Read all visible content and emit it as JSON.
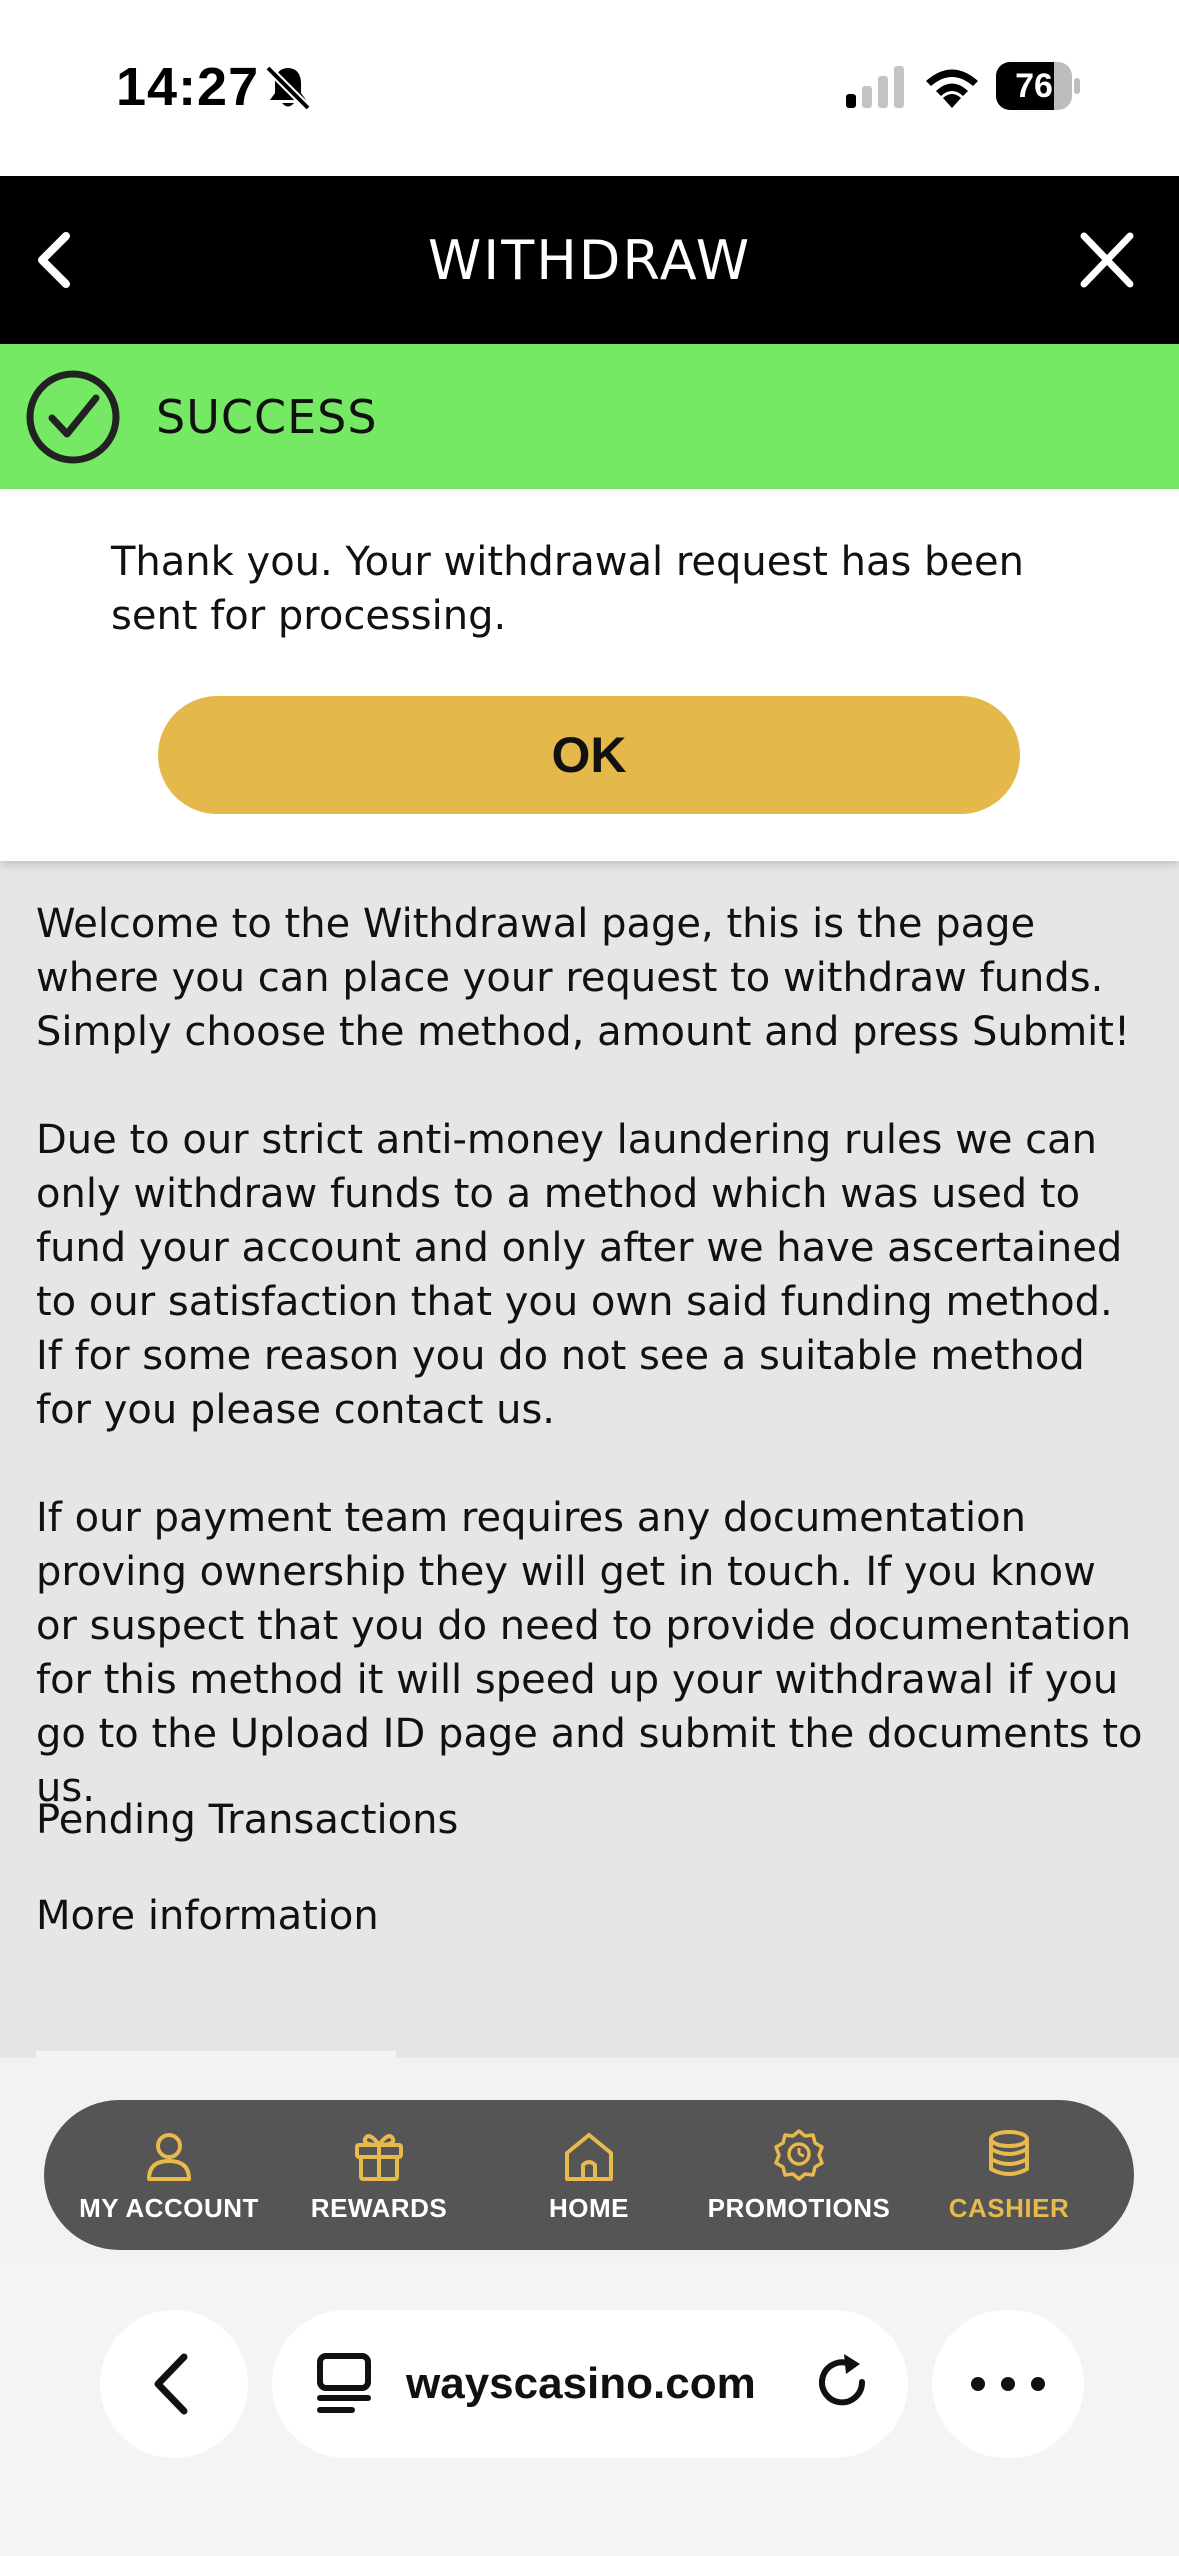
{
  "status_bar": {
    "time": "14:27",
    "battery": "76",
    "battery_level": 0.76
  },
  "header": {
    "title": "WITHDRAW"
  },
  "success": {
    "label": "SUCCESS",
    "color": "#76e964"
  },
  "message": {
    "text": "Thank you. Your withdrawal request has been sent for processing.",
    "ok_label": "OK",
    "button_color": "#e4b84a"
  },
  "content": {
    "paragraphs": [
      "Welcome to the Withdrawal page, this is the page where you can place your request to withdraw funds. Simply choose the method, amount and press Submit!",
      "Due to our strict anti-money laundering rules we can only withdraw funds to a method which was used to fund your account and only after we have ascertained to our satisfaction that you own said funding method. If for some reason you do not see a suitable method for you please contact us.",
      "If our payment team requires any documentation proving ownership they will get in touch. If you know or suspect that you do need to provide documentation for this method it will speed up your withdrawal if you go to the Upload ID page and submit the documents to us."
    ],
    "pending_transactions": "Pending Transactions",
    "more_information": "More information"
  },
  "bottom_nav": {
    "accent": "#e8b94c",
    "items": [
      {
        "label": "MY ACCOUNT",
        "icon": "user-icon"
      },
      {
        "label": "REWARDS",
        "icon": "gift-icon"
      },
      {
        "label": "HOME",
        "icon": "home-icon"
      },
      {
        "label": "PROMOTIONS",
        "icon": "badge-icon"
      },
      {
        "label": "CASHIER",
        "icon": "coins-icon",
        "active": true
      }
    ]
  },
  "browser": {
    "url": "wayscasino.com"
  }
}
